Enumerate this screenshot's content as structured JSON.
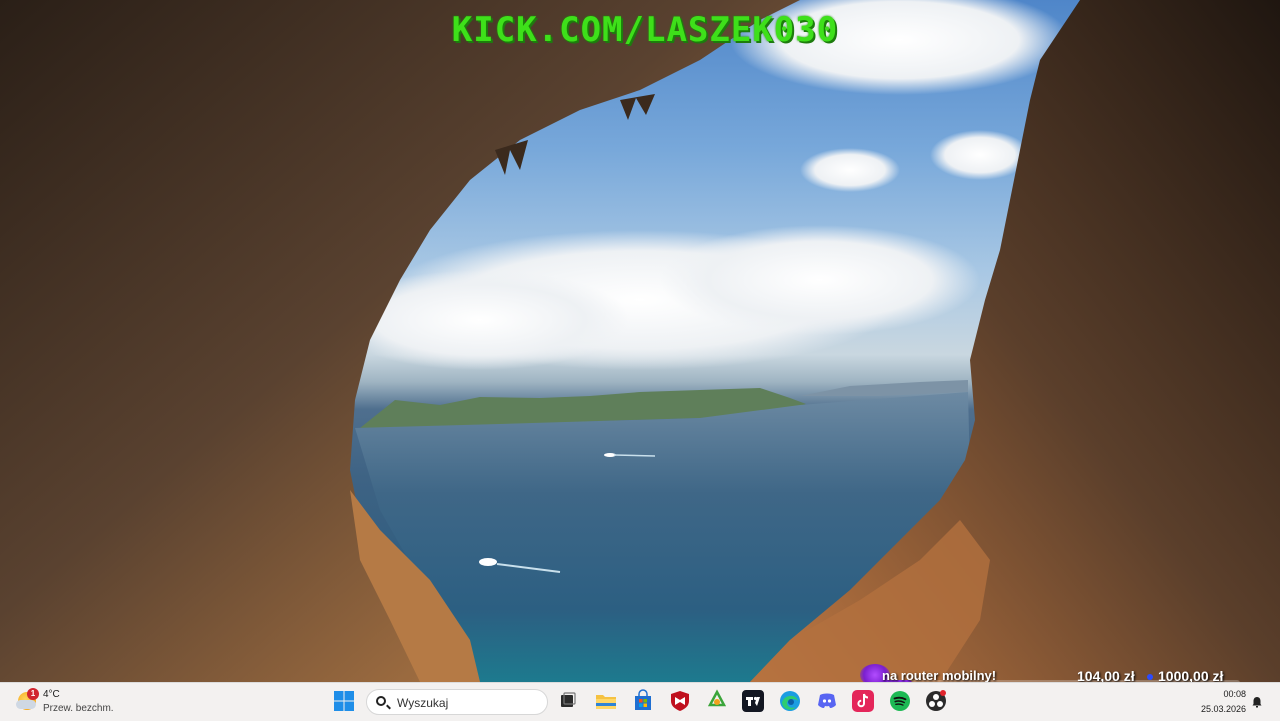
{
  "wallpaper": {
    "overlay_text": "KICK.COM/LASZEK030",
    "overlay_color": "#3ee01a"
  },
  "donation_widget": {
    "message": "na router mobilny!",
    "current_amount": "104,00 zł",
    "goal_amount": "1000,00 zł",
    "progress_fraction": 0.104,
    "accent_color": "#8a2be2"
  },
  "taskbar": {
    "weather": {
      "temperature": "4°C",
      "condition": "Przew. bezchm.",
      "badge_count": "1"
    },
    "start_icon": "windows-start-icon",
    "search": {
      "placeholder": "Wyszukaj"
    },
    "pinned_apps": [
      {
        "name": "task-view-icon"
      },
      {
        "name": "file-explorer-icon"
      },
      {
        "name": "microsoft-store-icon"
      },
      {
        "name": "mcafee-icon"
      },
      {
        "name": "recycle-app-icon"
      },
      {
        "name": "tradingview-icon"
      },
      {
        "name": "edge-icon"
      },
      {
        "name": "discord-icon"
      },
      {
        "name": "tiktok-icon"
      },
      {
        "name": "spotify-icon"
      },
      {
        "name": "obs-icon"
      }
    ],
    "clock": {
      "time": "00:08",
      "date": "25.03.2026"
    }
  }
}
